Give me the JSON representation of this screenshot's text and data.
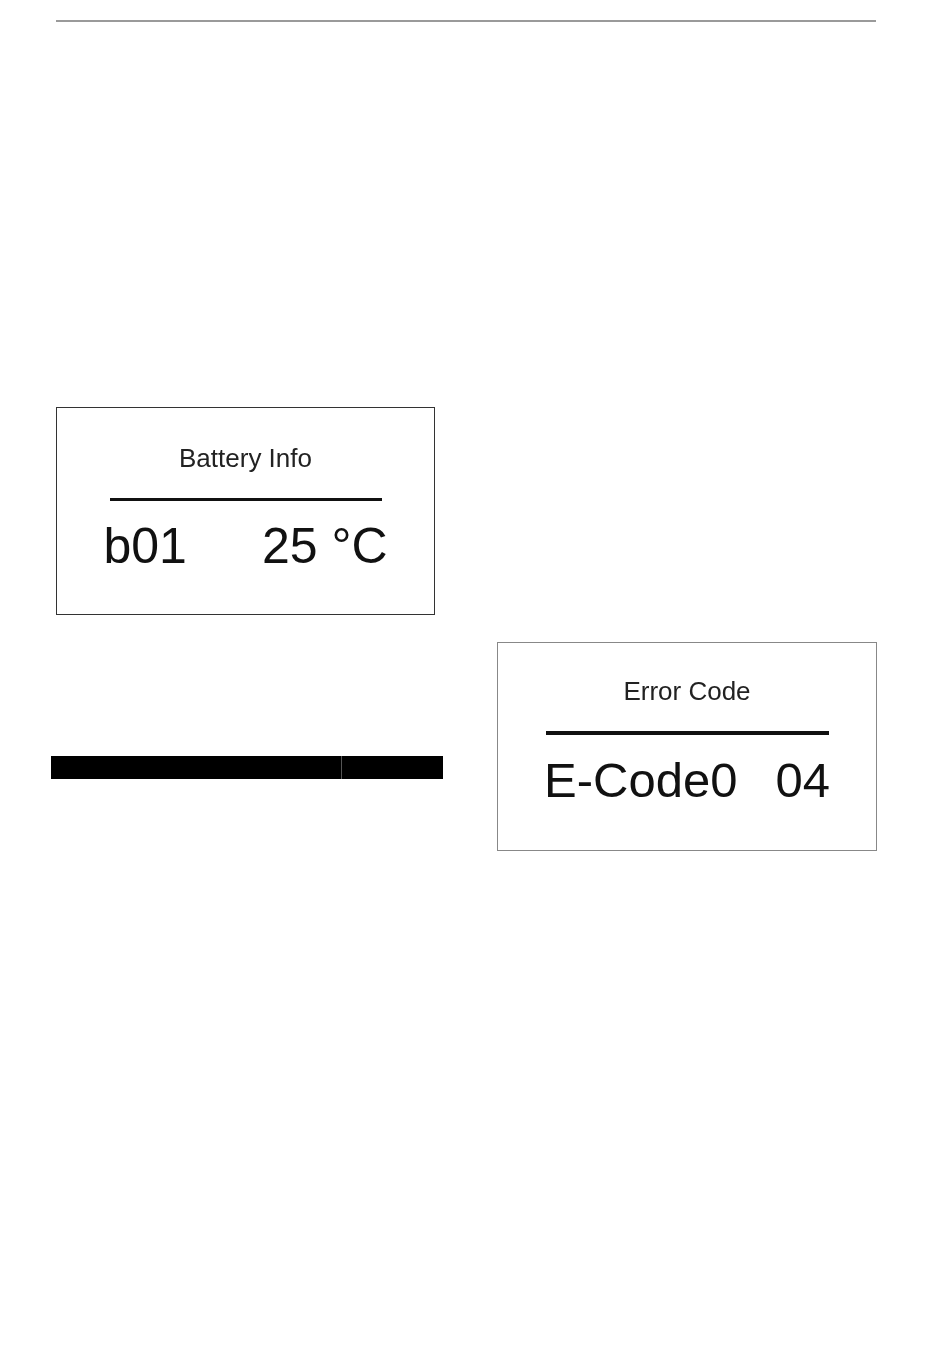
{
  "displays": [
    {
      "title": "Battery Info",
      "values": [
        "b01",
        "25 °C"
      ]
    },
    {
      "title": "Error Code",
      "values": [
        "E-Code0",
        "04"
      ]
    }
  ]
}
